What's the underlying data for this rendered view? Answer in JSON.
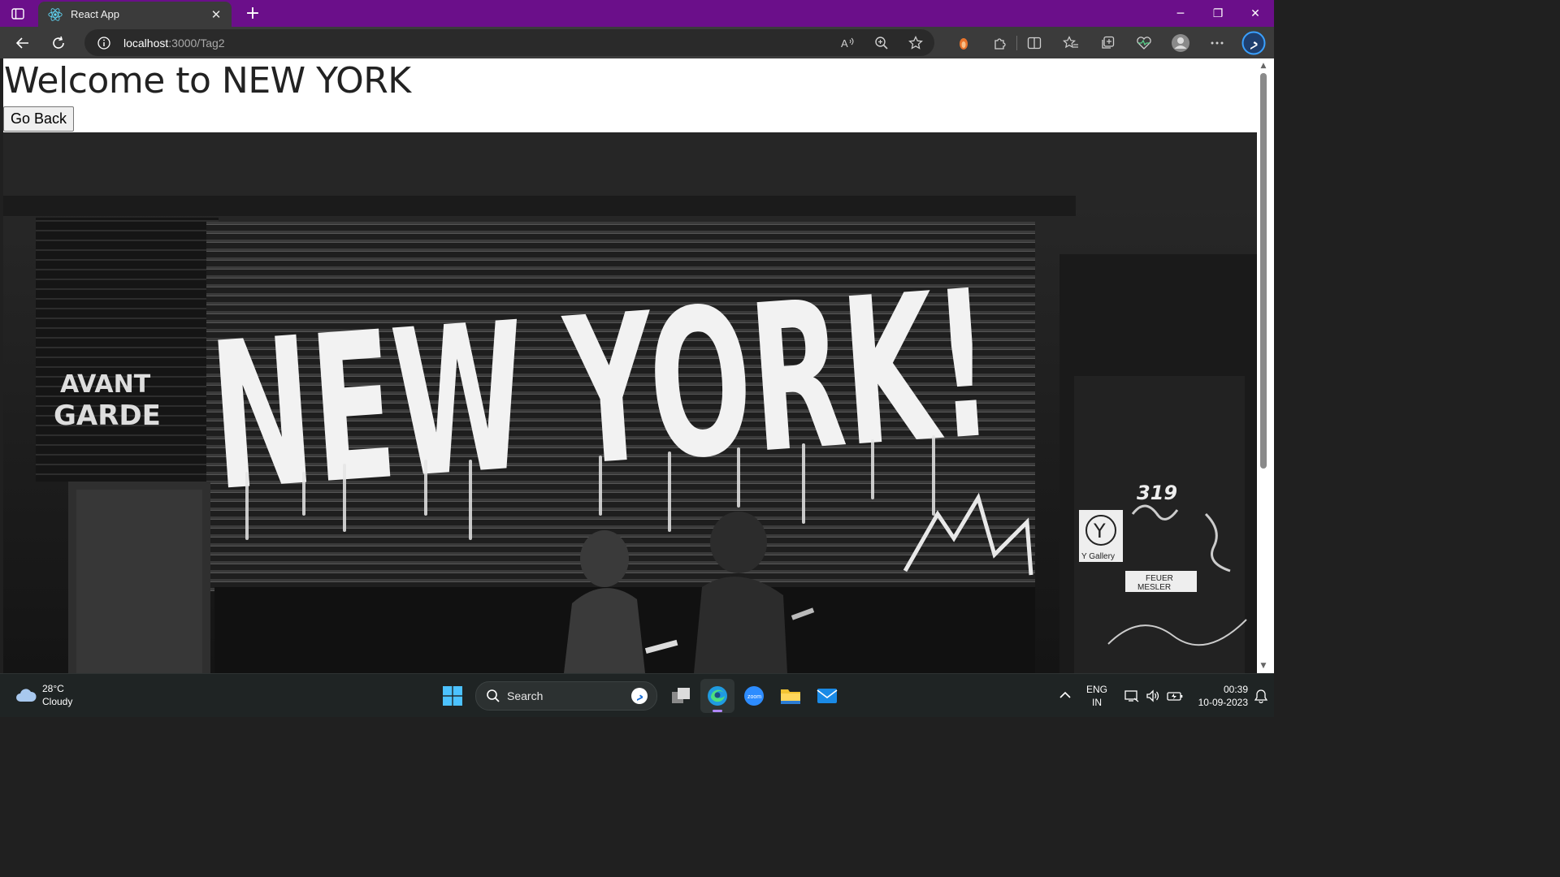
{
  "browser": {
    "tab": {
      "title": "React App",
      "favicon": "react-logo-icon",
      "close": "✕"
    },
    "new_tab": "+",
    "window_controls": {
      "minimize": "─",
      "restore": "❐",
      "close": "✕"
    },
    "address": {
      "host": "localhost",
      "path": ":3000/Tag2"
    },
    "toolbar_icons": [
      "read-aloud-icon",
      "zoom-icon",
      "favorite-star-icon",
      "extension-icon",
      "puzzle-icon",
      "split-screen-icon",
      "favorites-icon",
      "collections-icon",
      "performance-icon",
      "profile-avatar-icon",
      "more-menu-icon",
      "bing-copilot-icon"
    ],
    "accent": "#6b0f8a"
  },
  "page": {
    "heading": "Welcome to NEW YORK",
    "go_back_label": "Go Back",
    "photo": {
      "graffiti_text": "NEW YORK!",
      "sign_avant": "AVANT",
      "sign_garde": "GARDE",
      "number": "319",
      "gallery_letter": "Y",
      "gallery_label": "Y Gallery",
      "feuer_1": "FEUER",
      "feuer_2": "MESLER"
    }
  },
  "taskbar": {
    "weather": {
      "temp": "28°C",
      "condition": "Cloudy"
    },
    "search_label": "Search",
    "lang_1": "ENG",
    "lang_2": "IN",
    "time": "00:39",
    "date": "10-09-2023"
  }
}
